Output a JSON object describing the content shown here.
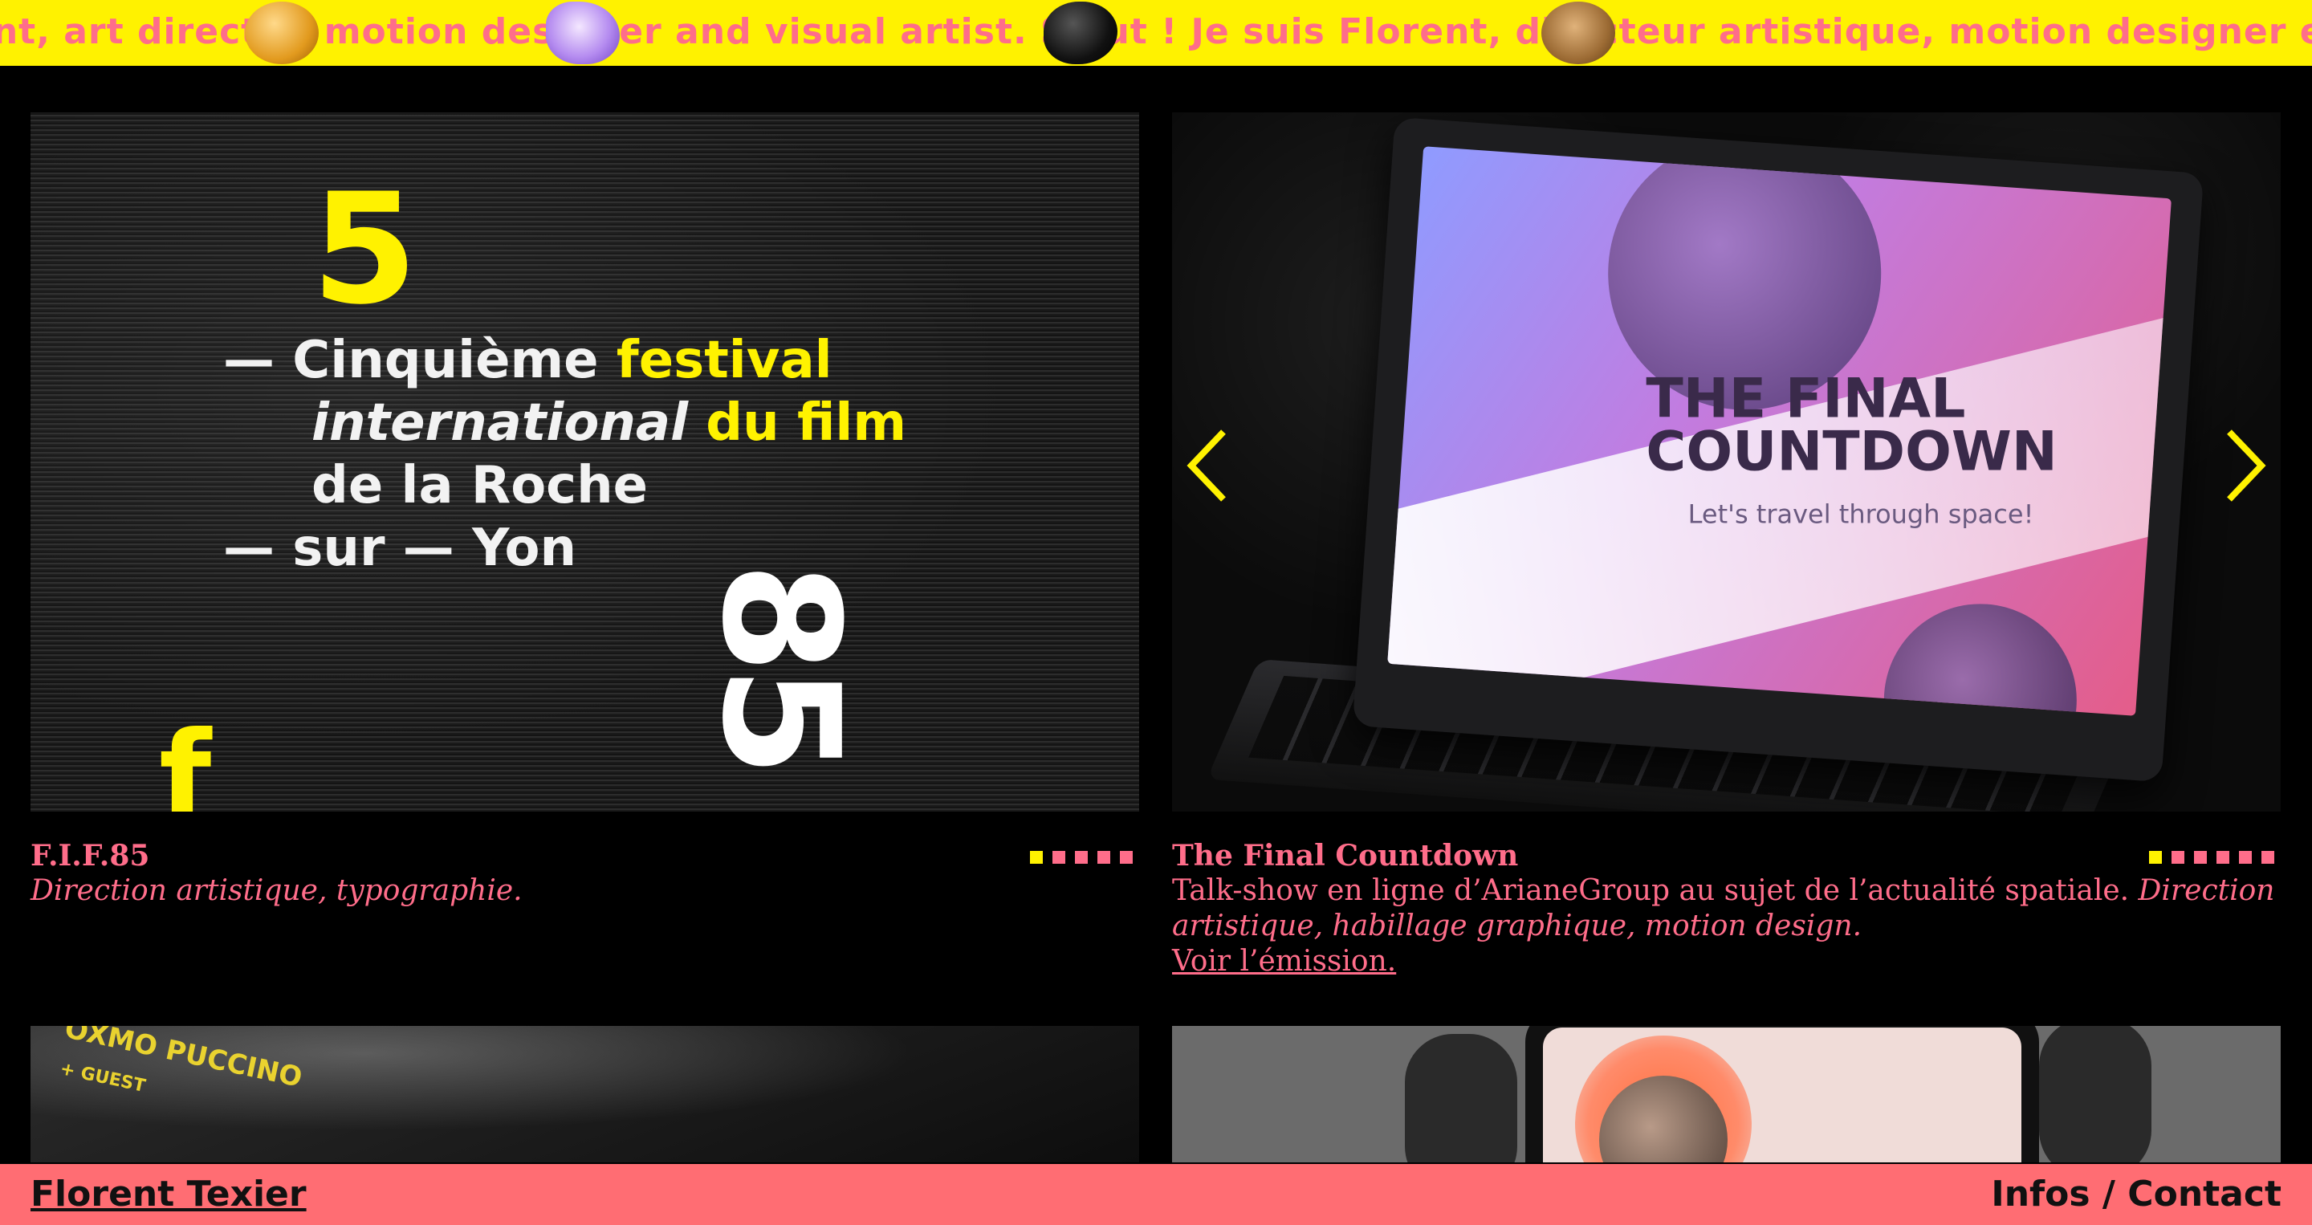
{
  "marquee": {
    "text": "ent, art director, motion designer and visual artist. Salut ! Je suis Florent, directeur artistique, motion designer et artiste visuel. Hi! I am"
  },
  "projects": [
    {
      "title": "F.I.F.85",
      "description": "",
      "roles": "Direction artistique, typographie.",
      "link": "",
      "slides": 5,
      "active_slide": 1,
      "artwork": {
        "number": "5",
        "line1_a": "— Cinquième ",
        "line1_b": "festival",
        "line2_a": "international",
        "line2_b": " du film",
        "line3": "de la Roche",
        "line4": "— sur — Yon",
        "rotated": "85",
        "mark": "f"
      }
    },
    {
      "title": "The Final Countdown",
      "description": "Talk-show en ligne d’ArianeGroup au sujet de l’actualité spatiale. ",
      "roles": "Direction artistique, habillage graphique, motion design.",
      "link": "Voir l’émission.",
      "slides": 6,
      "active_slide": 1,
      "artwork": {
        "screen_title": "THE FINAL COUNTDOWN",
        "screen_subtitle": "Let's travel through space!"
      }
    }
  ],
  "preview_left": {
    "text": "OXMO PUCCINO",
    "sub": "+ GUEST"
  },
  "footer": {
    "name": "Florent Texier",
    "contact": "Infos / Contact"
  },
  "colors": {
    "accent_yellow": "#fff200",
    "accent_pink": "#ff6d8a",
    "footer_bg": "#ff6d73"
  }
}
